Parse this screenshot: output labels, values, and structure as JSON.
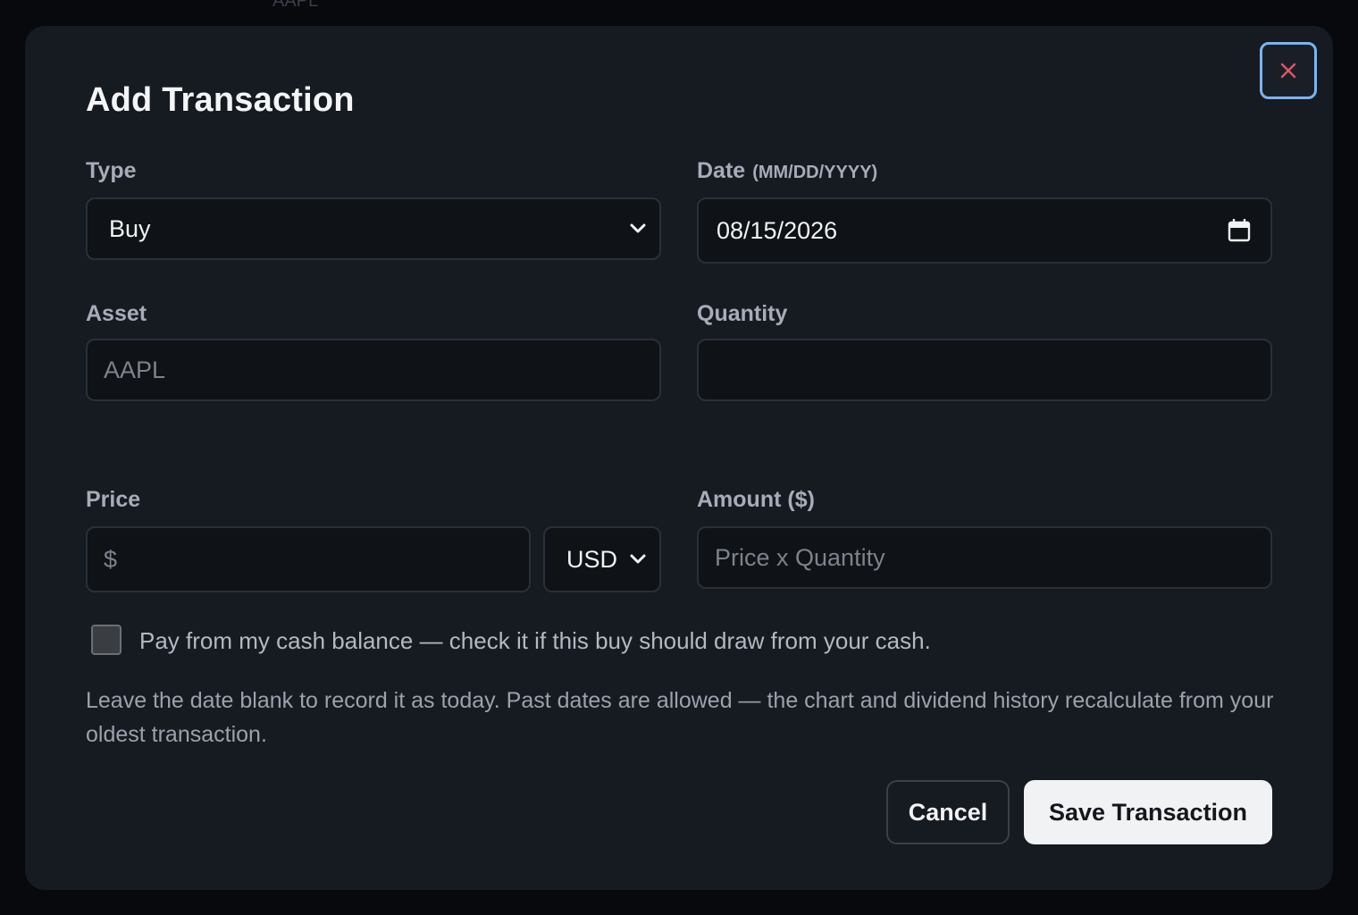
{
  "backdrop": {
    "cells": [
      "AAPL",
      "",
      ""
    ]
  },
  "modal": {
    "title": "Add Transaction",
    "close_icon": "close-icon"
  },
  "form": {
    "type": {
      "label": "Type",
      "value": "Buy"
    },
    "date": {
      "label": "Date",
      "hint": "(MM/DD/YYYY)",
      "value": "08/15/2026"
    },
    "asset": {
      "label": "Asset",
      "placeholder": "AAPL",
      "value": ""
    },
    "quantity": {
      "label": "Quantity",
      "placeholder": "",
      "value": ""
    },
    "price": {
      "label": "Price",
      "placeholder": "$",
      "value": "",
      "currency": "USD"
    },
    "amount": {
      "label": "Amount ($)",
      "placeholder": "Price x Quantity",
      "value": ""
    },
    "cash_checkbox": {
      "label": "Pay from my cash balance — check it if this buy should draw from your cash.",
      "checked": false
    },
    "note": "Leave the date blank to record it as today. Past dates are allowed — the chart and dividend history recalculate from your oldest transaction."
  },
  "buttons": {
    "cancel": "Cancel",
    "save": "Save Transaction"
  },
  "colors": {
    "modal_bg": "#161a21",
    "field_bg": "#0f1216",
    "close_accent": "#e05563",
    "focus_ring": "#7fb2ee"
  }
}
